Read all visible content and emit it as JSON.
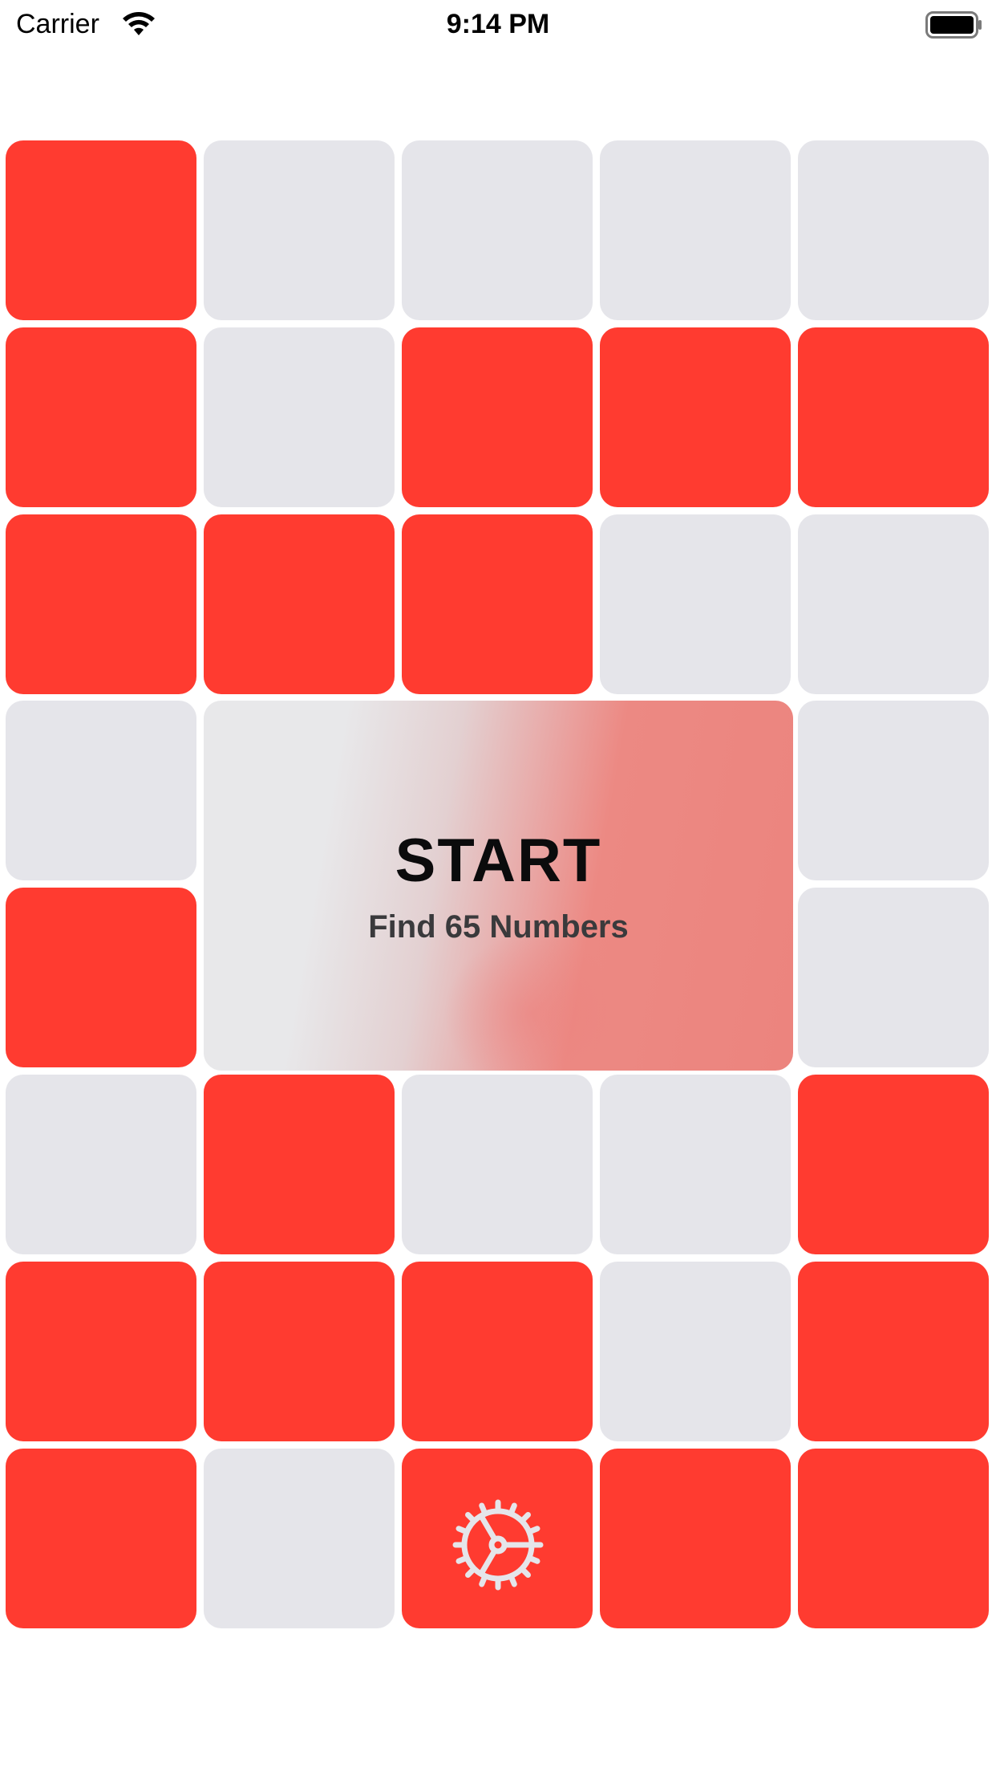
{
  "status_bar": {
    "carrier": "Carrier",
    "time": "9:14 PM",
    "icons": [
      "wifi-icon",
      "battery-icon"
    ]
  },
  "grid": {
    "rows": [
      [
        "red",
        "gray",
        "gray",
        "gray",
        "gray"
      ],
      [
        "red",
        "gray",
        "red",
        "red",
        "red"
      ],
      [
        "red",
        "red",
        "red",
        "gray",
        "gray"
      ],
      [
        "gray",
        "start",
        "start",
        "start",
        "gray"
      ],
      [
        "red",
        "start",
        "start",
        "start",
        "gray"
      ],
      [
        "gray",
        "red",
        "gray",
        "gray",
        "red"
      ],
      [
        "red",
        "red",
        "red",
        "gray",
        "red"
      ],
      [
        "red",
        "gray",
        "settings",
        "red",
        "red"
      ]
    ]
  },
  "start_panel": {
    "title": "START",
    "subtitle": "Find 65 Numbers"
  },
  "settings": {
    "icon": "gear-icon"
  },
  "colors": {
    "red": "#ff3b30",
    "gray": "#e5e5ea",
    "text_dark": "#0b0b0c",
    "text_subtitle": "#3a3a3c",
    "gear": "#e5e5ea"
  }
}
